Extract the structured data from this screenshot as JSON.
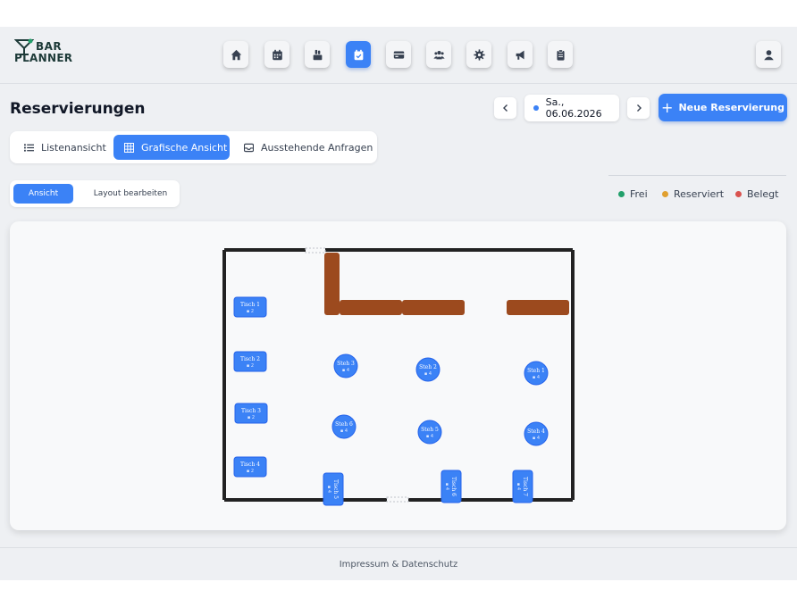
{
  "brand": {
    "line1": "BAR",
    "line2": "PLANNER"
  },
  "nav": [
    {
      "name": "home-icon",
      "active": false
    },
    {
      "name": "calendar-icon",
      "active": false
    },
    {
      "name": "inventory-icon",
      "active": false
    },
    {
      "name": "reservations-icon",
      "active": true
    },
    {
      "name": "cash-register-icon",
      "active": false
    },
    {
      "name": "staff-icon",
      "active": false
    },
    {
      "name": "settings-icon",
      "active": false
    },
    {
      "name": "announcement-icon",
      "active": false
    },
    {
      "name": "clipboard-icon",
      "active": false
    }
  ],
  "header": {
    "title": "Reservierungen",
    "date": "Sa., 06.06.2026",
    "new_button": "Neue Reservierung"
  },
  "tabs": [
    {
      "label": "Listenansicht",
      "icon": "list-icon",
      "active": false
    },
    {
      "label": "Grafische Ansicht",
      "icon": "grid-icon",
      "active": true
    },
    {
      "label": "Ausstehende Anfragen",
      "icon": "inbox-icon",
      "active": false
    }
  ],
  "mode": {
    "view": "Ansicht",
    "edit": "Layout bearbeiten"
  },
  "legend": [
    {
      "label": "Frei",
      "color": "#22a06b"
    },
    {
      "label": "Reserviert",
      "color": "#e0a030"
    },
    {
      "label": "Belegt",
      "color": "#d9534f"
    }
  ],
  "colors": {
    "accent": "#3b82f6",
    "bar": "#9c4a1e",
    "wall": "#222222"
  },
  "floor": {
    "tables": [
      {
        "label": "Tisch 1",
        "seats": "2",
        "shape": "rect"
      },
      {
        "label": "Tisch 2",
        "seats": "2",
        "shape": "rect"
      },
      {
        "label": "Tisch 3",
        "seats": "2",
        "shape": "rect"
      },
      {
        "label": "Tisch 4",
        "seats": "2",
        "shape": "rect"
      },
      {
        "label": "Tisch 5",
        "seats": "4",
        "shape": "rect-vertical"
      },
      {
        "label": "Tisch 6",
        "seats": "4",
        "shape": "rect-vertical"
      },
      {
        "label": "Tisch 7",
        "seats": "4",
        "shape": "rect-vertical"
      },
      {
        "label": "Steh 1",
        "seats": "4",
        "shape": "round"
      },
      {
        "label": "Steh 2",
        "seats": "4",
        "shape": "round"
      },
      {
        "label": "Steh 3",
        "seats": "4",
        "shape": "round"
      },
      {
        "label": "Steh 4",
        "seats": "4",
        "shape": "round"
      },
      {
        "label": "Steh 5",
        "seats": "4",
        "shape": "round"
      },
      {
        "label": "Steh 6",
        "seats": "4",
        "shape": "round"
      }
    ]
  },
  "footer": {
    "links": "Impressum & Datenschutz"
  }
}
